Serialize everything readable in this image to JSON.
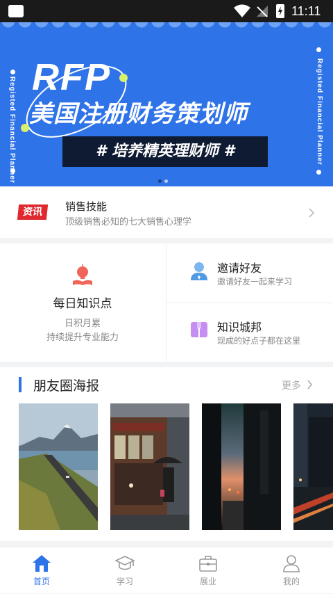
{
  "status_bar": {
    "time": "11:11"
  },
  "banner": {
    "logo": "RFP",
    "title": "美国注册财务策划师",
    "slogan": "# 培养精英理财师 #",
    "side_text_left": "Registed Financial Planner",
    "side_text_right": "Registed Financial Planner",
    "carousel_index": 0,
    "carousel_count": 2
  },
  "news": {
    "badge": "资讯",
    "title": "销售技能",
    "subtitle": "顶级销售必知的七大销售心理学"
  },
  "features": {
    "daily": {
      "title": "每日知识点",
      "line1": "日积月累",
      "line2": "持续提升专业能力"
    },
    "invite": {
      "title": "邀请好友",
      "subtitle": "邀请好友一起来学习"
    },
    "city": {
      "title": "知识城邦",
      "subtitle": "现成的好点子都在这里"
    }
  },
  "posters": {
    "title": "朋友圈海报",
    "more": "更多",
    "items": [
      {
        "scene": "mountain-lake-road"
      },
      {
        "scene": "tram-rainy-street"
      },
      {
        "scene": "city-street-dusk"
      },
      {
        "scene": "night-city-traffic"
      }
    ]
  },
  "tabbar": {
    "items": [
      {
        "label": "首页",
        "icon": "home-icon",
        "active": true
      },
      {
        "label": "学习",
        "icon": "graduation-cap-icon",
        "active": false
      },
      {
        "label": "展业",
        "icon": "briefcase-icon",
        "active": false
      },
      {
        "label": "我的",
        "icon": "user-icon",
        "active": false
      }
    ]
  },
  "colors": {
    "accent": "#2f73e8",
    "badge": "#e0282e",
    "banner_bg": "#2f73e8",
    "slogan_bg": "#0f1b33"
  }
}
